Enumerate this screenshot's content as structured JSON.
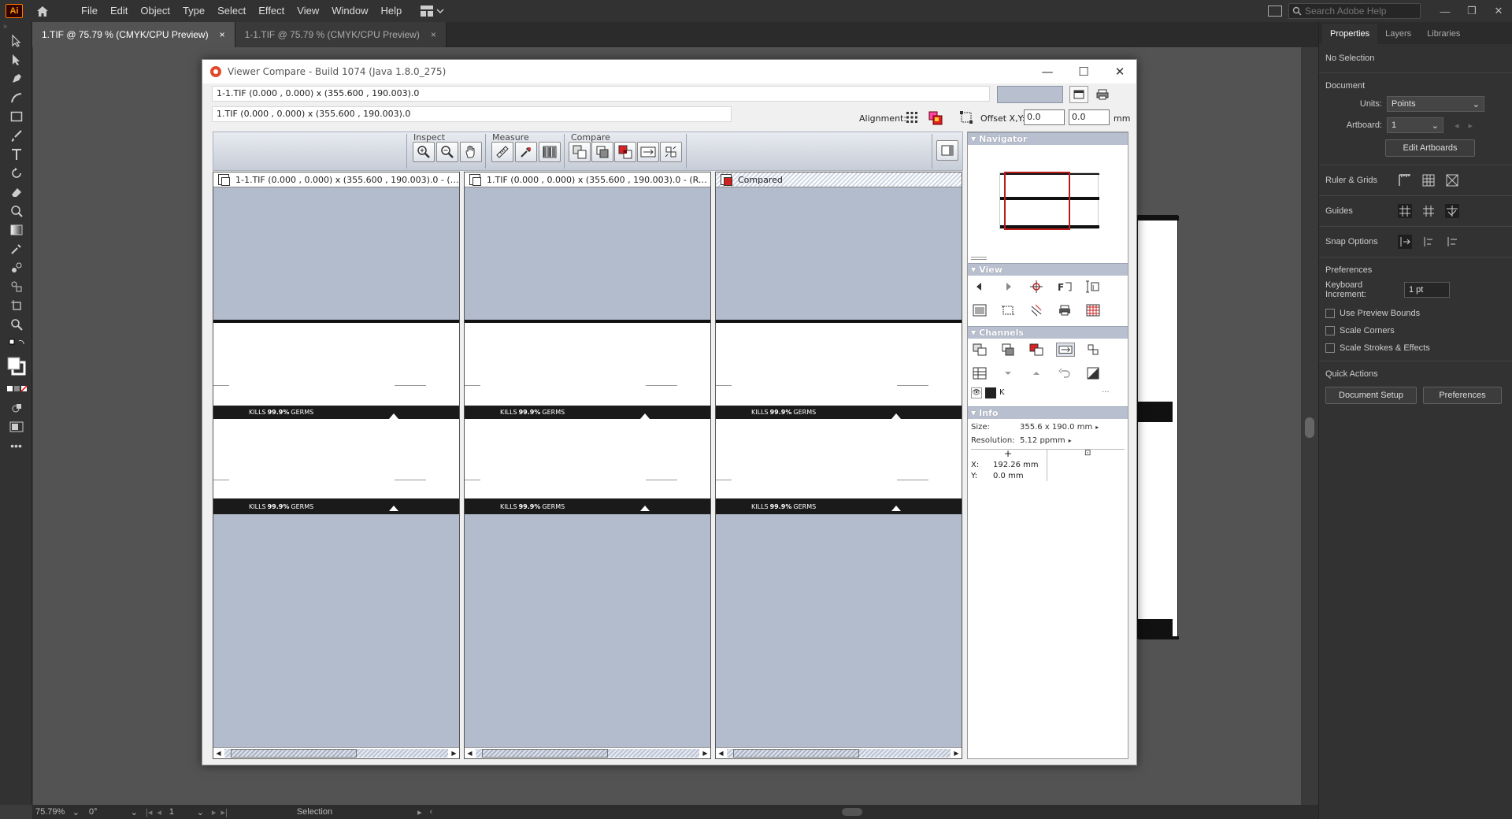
{
  "app": {
    "logo": "Ai",
    "menus": [
      "File",
      "Edit",
      "Object",
      "Type",
      "Select",
      "Effect",
      "View",
      "Window",
      "Help"
    ],
    "search_placeholder": "Search Adobe Help",
    "window_controls": [
      "—",
      "❐",
      "✕"
    ]
  },
  "doc_tabs": [
    {
      "label": "1.TIF @ 75.79 % (CMYK/CPU Preview)",
      "active": true
    },
    {
      "label": "1-1.TIF @ 75.79 % (CMYK/CPU Preview)",
      "active": false
    }
  ],
  "tab_close": "×",
  "status": {
    "zoom": "75.79%",
    "rotation": "0°",
    "artboard": "1",
    "tool": "Selection"
  },
  "properties": {
    "tabs": [
      "Properties",
      "Layers",
      "Libraries"
    ],
    "no_selection": "No Selection",
    "document_label": "Document",
    "units_label": "Units:",
    "units_value": "Points",
    "artboard_label": "Artboard:",
    "artboard_value": "1",
    "edit_artboards": "Edit Artboards",
    "ruler_grids": "Ruler & Grids",
    "guides": "Guides",
    "snap_options": "Snap Options",
    "preferences_label": "Preferences",
    "keyboard_increment_label": "Keyboard Increment:",
    "keyboard_increment_value": "1 pt",
    "checkboxes": [
      "Use Preview Bounds",
      "Scale Corners",
      "Scale Strokes & Effects"
    ],
    "quick_actions": "Quick Actions",
    "document_setup": "Document Setup",
    "preferences_button": "Preferences"
  },
  "viewer": {
    "title": "Viewer Compare - Build 1074 (Java 1.8.0_275)",
    "controls": [
      "—",
      "☐",
      "✕"
    ],
    "current_file": "1-1.TIF (0.000 , 0.000) x (355.600 , 190.003).0",
    "reference_file": "1.TIF (0.000 , 0.000) x (355.600 , 190.003).0",
    "alignment_label": "Alignment:",
    "offset_label": "Offset X,Y:",
    "offset_x": "0.0",
    "offset_y": "0.0",
    "unit": "mm",
    "groups": {
      "inspect": "Inspect",
      "measure": "Measure",
      "compare": "Compare"
    },
    "panes": [
      {
        "header": "1-1.TIF (0.000 , 0.000) x (355.600 , 190.003).0 - (Cur...",
        "type": "current"
      },
      {
        "header": "1.TIF (0.000 , 0.000) x (355.600 , 190.003).0 - (Refer...",
        "type": "reference"
      },
      {
        "header": "Compared",
        "type": "compared"
      }
    ],
    "art_text_prefix": "KILLS",
    "art_text_bold": "99.9%",
    "art_text_suffix": "GERMS",
    "sections": {
      "navigator": "Navigator",
      "view": "View",
      "channels": "Channels",
      "info": "Info"
    },
    "channel_name": "K",
    "channel_more": "...",
    "info": {
      "size_label": "Size:",
      "size_value": "355.6 x 190.0 mm",
      "resolution_label": "Resolution:",
      "resolution_value": "5.12 ppmm",
      "x_label": "X:",
      "x_value": "192.26 mm",
      "y_label": "Y:",
      "y_value": "0.0 mm"
    }
  },
  "colors": {
    "ai_orange": "#ff9a00",
    "pane_bg": "#b3bccc",
    "section_head": "#b8c0d0",
    "nav_red": "#b81c1c"
  }
}
